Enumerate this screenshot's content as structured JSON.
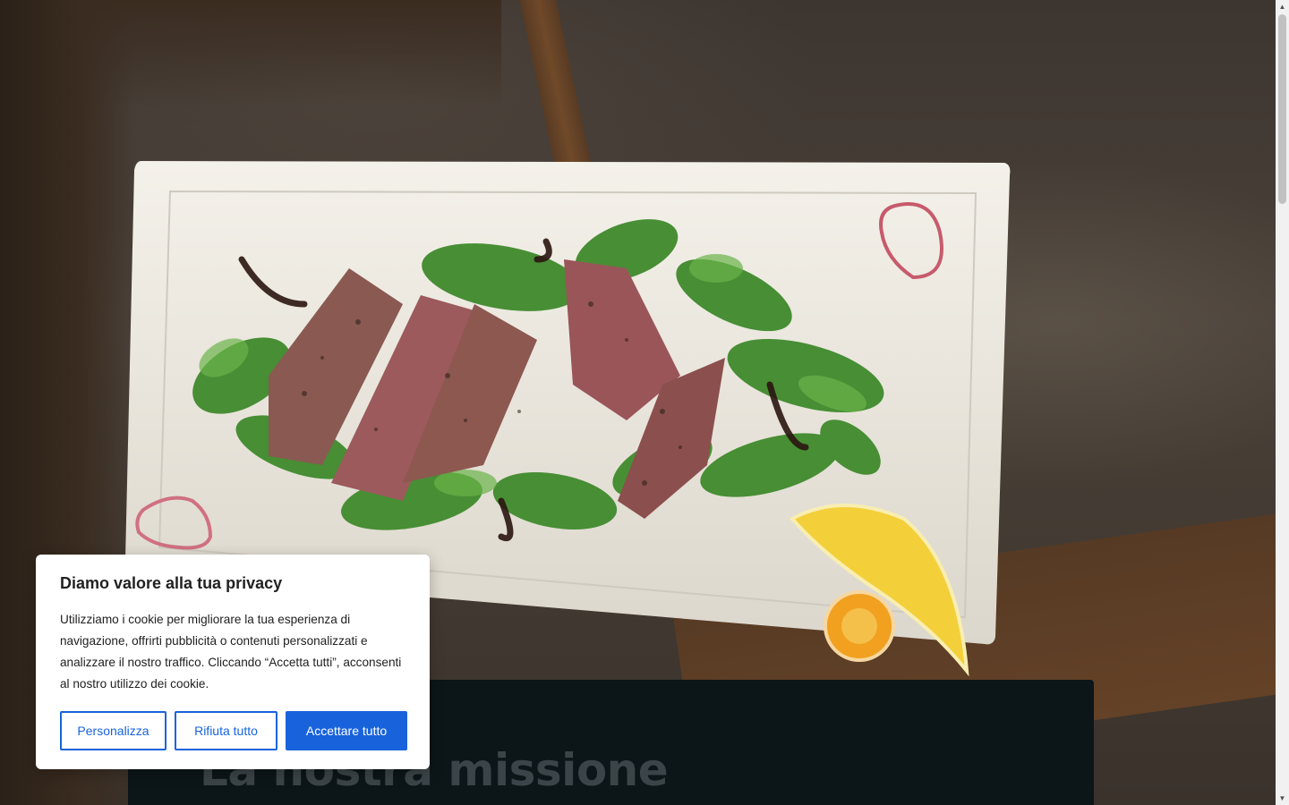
{
  "mission": {
    "heading": "La nostra missione"
  },
  "cookie_banner": {
    "title": "Diamo valore alla tua privacy",
    "body": "Utilizziamo i cookie per migliorare la tua esperienza di navigazione, offrirti pubblicità o contenuti personalizzati e analizzare il nostro traffico. Cliccando “Accetta tutti”, acconsenti al nostro utilizzo dei cookie.",
    "customize_label": "Personalizza",
    "reject_label": "Rifiuta tutto",
    "accept_label": "Accettare tutto"
  },
  "scrollbar": {
    "up_icon": "▲",
    "down_icon": "▼"
  },
  "colors": {
    "accent": "#1863dc",
    "mission_bg": "#0c1518",
    "mission_heading": "#3b4448"
  }
}
